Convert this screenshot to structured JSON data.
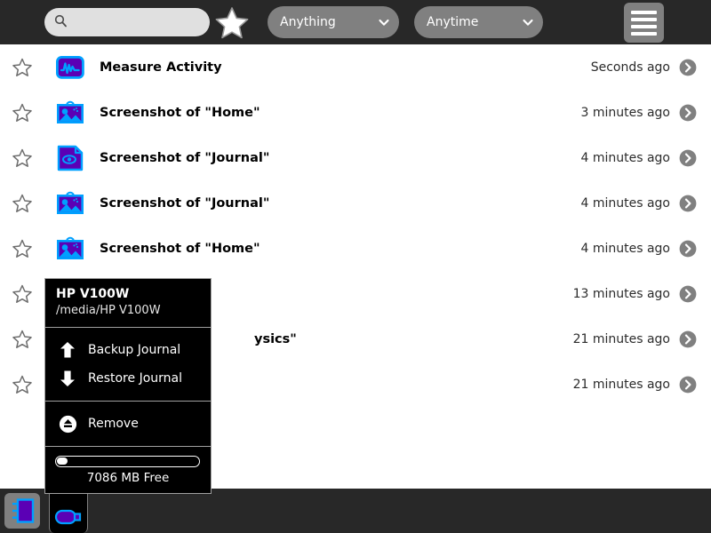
{
  "toolbar": {
    "search": {
      "value": "",
      "placeholder": "",
      "icon": "search-icon"
    },
    "favorite_star": {
      "icon": "star-icon"
    },
    "type_filter": {
      "value": "Anything",
      "icon": "chevron-down-icon"
    },
    "time_filter": {
      "value": "Anytime",
      "icon": "chevron-down-icon"
    },
    "menu_button": {
      "icon": "hamburger-icon"
    }
  },
  "list": {
    "rows": [
      {
        "title": "Measure Activity",
        "time": "Seconds ago",
        "icon": "measure-activity-icon",
        "starred": false,
        "hidden_title": false
      },
      {
        "title": "Screenshot of \"Home\"",
        "time": "3 minutes ago",
        "icon": "picture-icon",
        "starred": false,
        "hidden_title": false
      },
      {
        "title": "Screenshot of \"Journal\"",
        "time": "4 minutes ago",
        "icon": "document-eye-icon",
        "starred": false,
        "hidden_title": false
      },
      {
        "title": "Screenshot of \"Journal\"",
        "time": "4 minutes ago",
        "icon": "picture-icon",
        "starred": false,
        "hidden_title": false
      },
      {
        "title": "Screenshot of \"Home\"",
        "time": "4 minutes ago",
        "icon": "picture-icon",
        "starred": false,
        "hidden_title": false
      },
      {
        "title": "",
        "time": "13 minutes ago",
        "icon": "",
        "starred": false,
        "hidden_title": true
      },
      {
        "title": "ysics\"",
        "time": "21 minutes ago",
        "icon": "",
        "starred": false,
        "hidden_title": true
      },
      {
        "title": "",
        "time": "21 minutes ago",
        "icon": "",
        "starred": false,
        "hidden_title": true
      }
    ],
    "arrow_icon": "chevron-right-circle-icon",
    "star_icon": "star-outline-icon"
  },
  "popup": {
    "title": "HP V100W",
    "path": "/media/HP V100W",
    "items": [
      {
        "label": "Backup Journal",
        "icon": "arrow-up-icon"
      },
      {
        "label": "Restore Journal",
        "icon": "arrow-down-icon"
      },
      {
        "label": "Remove",
        "icon": "eject-icon"
      }
    ],
    "storage": {
      "label": "7086 MB Free",
      "fill_percent": 3
    }
  },
  "taskbar": {
    "buttons": [
      {
        "name": "journal",
        "icon": "journal-icon",
        "active": true
      },
      {
        "name": "usb-drive",
        "icon": "usb-icon",
        "active": false
      }
    ]
  },
  "colors": {
    "toolbar_bg": "#282828",
    "pill_bg": "#808080",
    "accent_cyan": "#00a0ff",
    "accent_purple": "#5b00b5",
    "popup_bg": "#000000",
    "page_bg": "#ffffff"
  }
}
